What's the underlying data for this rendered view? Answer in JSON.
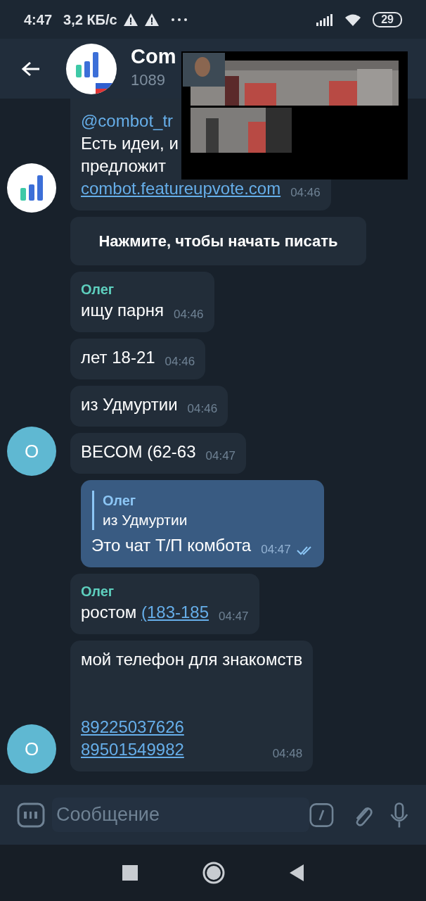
{
  "status_bar": {
    "time": "4:47",
    "speed": "3,2 КБ/с",
    "battery": "29"
  },
  "header": {
    "title": "Com",
    "subtitle": "1089"
  },
  "messages": [
    {
      "kind": "incoming",
      "avatar": {
        "kind": "bot"
      },
      "time": "04:46",
      "lines": [
        {
          "segments": [
            {
              "kind": "mention",
              "text": "@combot_tr"
            }
          ]
        },
        {
          "segments": [
            {
              "kind": "text",
              "text": "Есть идеи, и"
            }
          ]
        },
        {
          "segments": [
            {
              "kind": "text",
              "text": "предложит"
            }
          ]
        },
        {
          "segments": [
            {
              "kind": "link",
              "text": "combot.featureupvote.com"
            }
          ]
        }
      ]
    },
    {
      "kind": "service",
      "text": "Нажмите, чтобы начать писать"
    },
    {
      "kind": "incoming",
      "sender": "Олег",
      "time": "04:46",
      "lines": [
        {
          "segments": [
            {
              "kind": "text",
              "text": "ищу парня"
            }
          ]
        }
      ]
    },
    {
      "kind": "incoming",
      "time": "04:46",
      "lines": [
        {
          "segments": [
            {
              "kind": "text",
              "text": "лет 18-21"
            }
          ]
        }
      ]
    },
    {
      "kind": "incoming",
      "time": "04:46",
      "lines": [
        {
          "segments": [
            {
              "kind": "text",
              "text": "из Удмуртии"
            }
          ]
        }
      ]
    },
    {
      "kind": "incoming",
      "avatar": {
        "kind": "letter",
        "letter": "О"
      },
      "time": "04:47",
      "lines": [
        {
          "segments": [
            {
              "kind": "text",
              "text": "ВЕСОМ (62-63"
            }
          ]
        }
      ]
    },
    {
      "kind": "outgoing",
      "reply": {
        "name": "Олег",
        "text": "из Удмуртии"
      },
      "time": "04:47",
      "read": true,
      "lines": [
        {
          "segments": [
            {
              "kind": "text",
              "text": "Это чат Т/П комбота"
            }
          ]
        }
      ]
    },
    {
      "kind": "incoming",
      "sender": "Олег",
      "time": "04:47",
      "lines": [
        {
          "segments": [
            {
              "kind": "text",
              "text": "ростом "
            },
            {
              "kind": "link",
              "text": "(183-185"
            }
          ]
        }
      ]
    },
    {
      "kind": "incoming",
      "avatar": {
        "kind": "letter",
        "letter": "О"
      },
      "time": "04:48",
      "lines": [
        {
          "segments": [
            {
              "kind": "text",
              "text": "мой телефон для знакомств"
            }
          ]
        },
        {
          "kind": "blank"
        },
        {
          "kind": "blank"
        },
        {
          "segments": [
            {
              "kind": "link",
              "text": "89225037626"
            }
          ]
        },
        {
          "segments": [
            {
              "kind": "link",
              "text": "89501549982"
            }
          ]
        }
      ]
    }
  ],
  "composer": {
    "placeholder": "Сообщение"
  }
}
